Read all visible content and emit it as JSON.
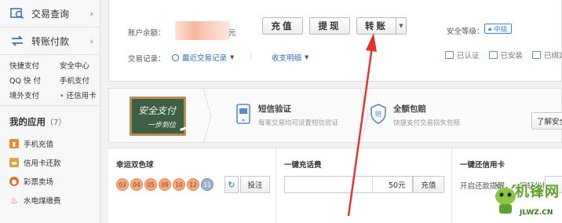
{
  "sidebar": {
    "nav": [
      {
        "label": "交易查询",
        "icon": "search-icon"
      },
      {
        "label": "转账付款",
        "icon": "transfer-icon"
      }
    ],
    "quick_links": [
      "快捷支付",
      "安全中心",
      "QQ 快 付",
      "手机支付",
      "境外支付",
      "还信用卡"
    ],
    "apps_title": "我的应用",
    "apps_count": "（7）",
    "apps": [
      {
        "label": "手机充值",
        "icon": "phone-icon",
        "color": "#e88b2d"
      },
      {
        "label": "信用卡还款",
        "icon": "credit-card-icon",
        "color": "#e0a23a"
      },
      {
        "label": "彩票卖场",
        "icon": "lottery-icon",
        "color": "#e56d2a"
      },
      {
        "label": "水电煤缴费",
        "icon": "flame-icon",
        "color": "#e04a2e"
      }
    ]
  },
  "account": {
    "balance_label": "账户余额：",
    "balance_unit": "元",
    "buttons": {
      "recharge": "充值",
      "withdraw": "提现",
      "transfer": "转账"
    },
    "security_label": "安全等级：",
    "security_level": "中级",
    "records_label": "交易记录：",
    "recent_records": "最近交易记录",
    "income_expense": "收支明细",
    "security_items": [
      "已认证",
      "已安装",
      "已绑定"
    ]
  },
  "banner": {
    "board_line1": "安全支付",
    "board_line2": "一步到位",
    "features": [
      {
        "title": "短信验证",
        "desc": "每笔交易均可设置短信验证",
        "icon": "phone-sms-icon"
      },
      {
        "title": "全额包赔",
        "desc": "快捷支付交易损失包赔",
        "icon": "shield-icon"
      }
    ],
    "learn_more": "了解安全"
  },
  "apps_row": {
    "lottery": {
      "title": "幸运双色球",
      "red_balls": [
        "03",
        "04",
        "05",
        "09",
        "10",
        "12"
      ],
      "blue_ball": "11",
      "bet_label": "投注"
    },
    "phone_recharge": {
      "title": "一键充话费",
      "amount": "50元",
      "button": "充值"
    },
    "credit_card": {
      "title": "一键还信用卡",
      "remind": "开启还款提醒，一键轻松搞定"
    }
  },
  "watermark": {
    "text": "机锋网",
    "url": "JLWZ.CN"
  },
  "colors": {
    "accent_blue": "#2b6fc2",
    "arrow_red": "#e4302b",
    "ball_red": "#f4a880",
    "ball_blue": "#9ab2cf"
  }
}
